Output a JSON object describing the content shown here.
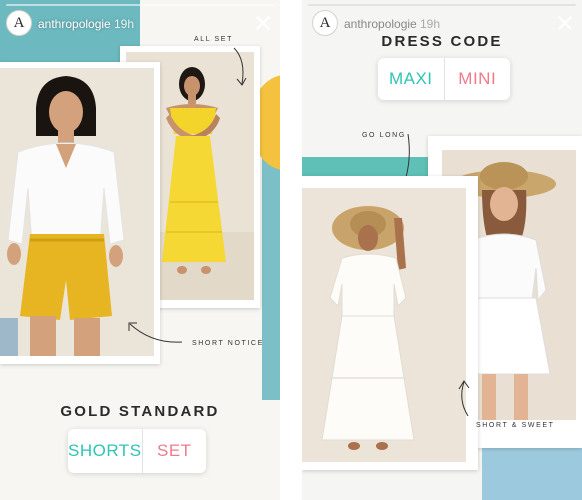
{
  "colors": {
    "teal_option": "#2ec4b6",
    "pink_option": "#ef7b8a",
    "yellow_accent": "#f4c23e",
    "teal_paper": "#5fb7c2"
  },
  "stories": [
    {
      "account": {
        "avatar_letter": "A",
        "username": "anthropologie",
        "timestamp": "19h"
      },
      "annotations": {
        "top": "ALL SET",
        "bottom": "SHORT NOTICE"
      },
      "headline": "GOLD STANDARD",
      "poll": {
        "option_a": "SHORTS",
        "option_b": "SET"
      }
    },
    {
      "account": {
        "avatar_letter": "A",
        "username": "anthropologie",
        "timestamp": "19h"
      },
      "headline": "DRESS CODE",
      "poll": {
        "option_a": "MAXI",
        "option_b": "MINI"
      },
      "annotations": {
        "top": "GO LONG",
        "bottom": "SHORT & SWEET"
      }
    }
  ]
}
